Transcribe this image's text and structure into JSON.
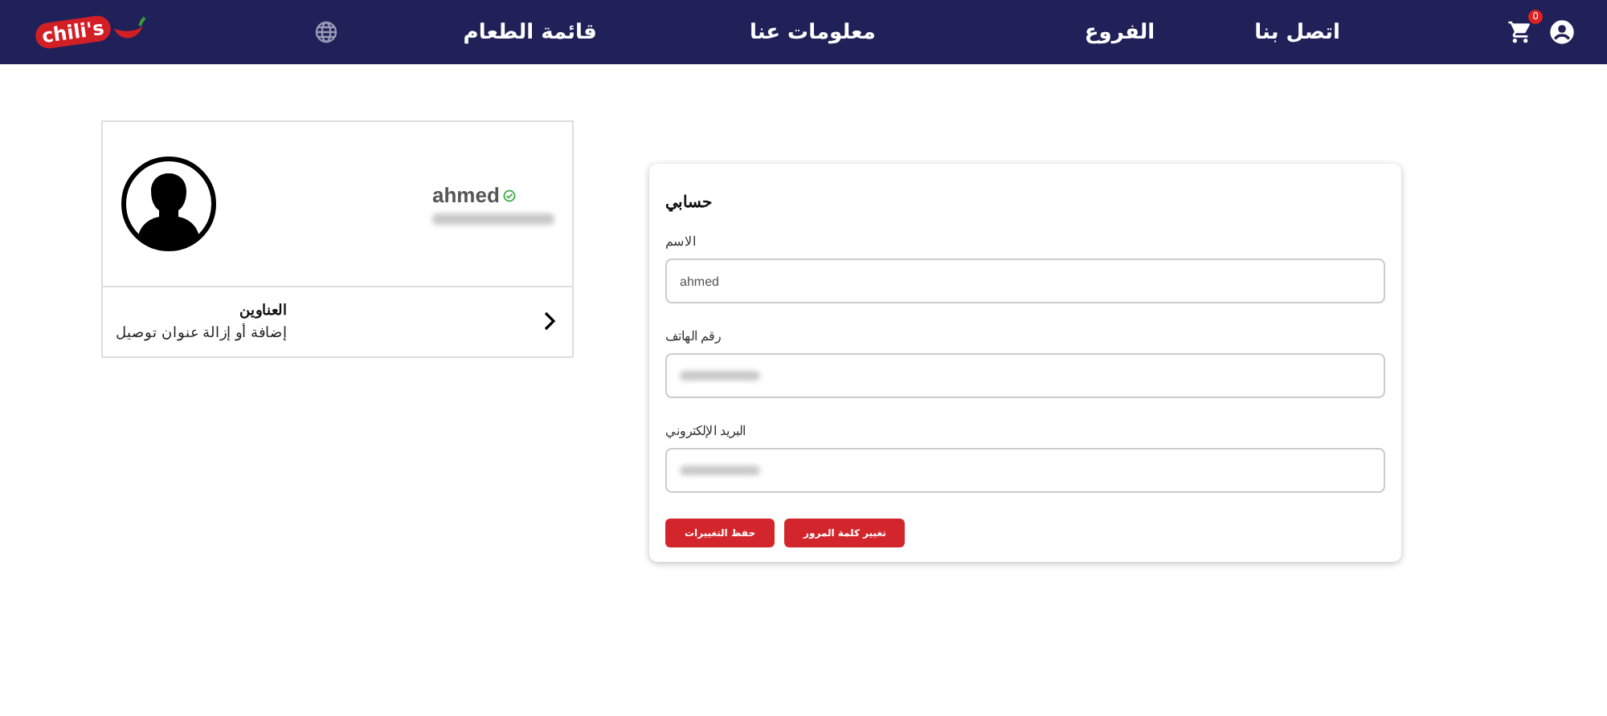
{
  "navbar": {
    "logo": "chili's",
    "menu": [
      {
        "label": "اتصل بنا"
      },
      {
        "label": "الفروع"
      },
      {
        "label": "معلومات عنا"
      },
      {
        "label": "قائمة الطعام"
      }
    ],
    "cart_count": "0"
  },
  "profile": {
    "name": "ahmed",
    "verified": true,
    "addresses": {
      "title": "العناوين",
      "subtitle": "إضافة أو إزالة عنوان توصيل"
    }
  },
  "account_form": {
    "title": "حسابي",
    "fields": [
      {
        "label": "الاسم",
        "value": "ahmed",
        "blurred": false
      },
      {
        "label": "رقم الهاتف",
        "blurred": true
      },
      {
        "label": "البريد الإلكتروني",
        "blurred": true
      }
    ],
    "buttons": [
      "تغيير كلمة المرور",
      "حفظ التغييرات"
    ]
  }
}
